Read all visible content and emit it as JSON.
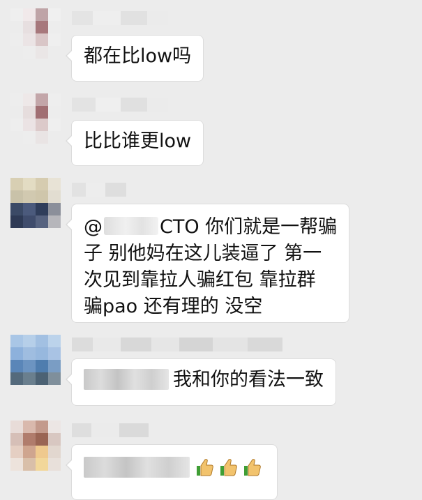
{
  "messages": [
    {
      "id": "m1",
      "text": "都在比low吗"
    },
    {
      "id": "m2",
      "text": "比比谁更low"
    },
    {
      "id": "m3",
      "lines": [
        "@ CTO 你们就是一帮骗",
        "子 别他妈在这儿装逼了 第一",
        "次见到靠拉人骗红包 靠拉群",
        "骗pao 还有理的 没空"
      ],
      "line1_prefix": "@",
      "line1_suffix": "CTO 你们就是一帮骗"
    },
    {
      "id": "m4",
      "text": "我和你的看法一致"
    },
    {
      "id": "m5",
      "emoji": "thumbs-up-icon"
    }
  ],
  "colors": {
    "background": "#ececec",
    "bubble": "#ffffff",
    "bubble_border": "#dcdcdc",
    "text": "#111111"
  }
}
